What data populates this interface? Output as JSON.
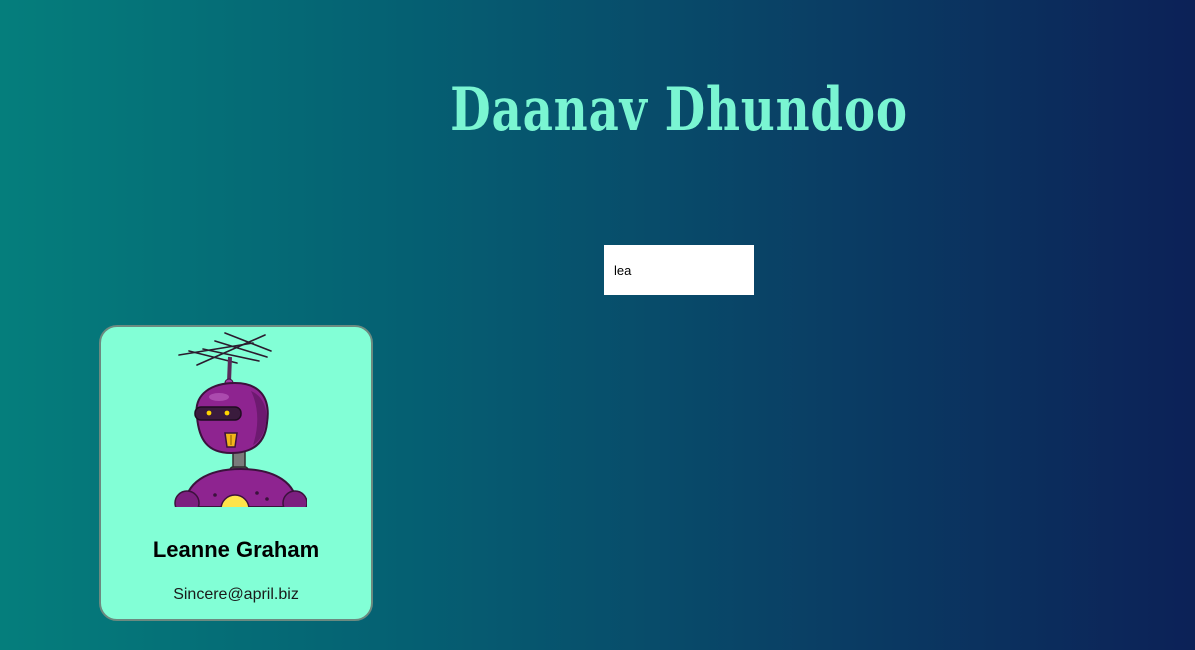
{
  "app": {
    "title": "Daanav Dhundoo"
  },
  "search": {
    "value": "lea",
    "placeholder": ""
  },
  "results": [
    {
      "name": "Leanne Graham",
      "email": "Sincere@april.biz",
      "avatar": "robot-avatar"
    }
  ],
  "colors": {
    "title": "#7af5d2",
    "card_background": "#82ffd6",
    "robot_body": "#8e2490",
    "background_start": "#057e7c",
    "background_end": "#0c2157"
  }
}
